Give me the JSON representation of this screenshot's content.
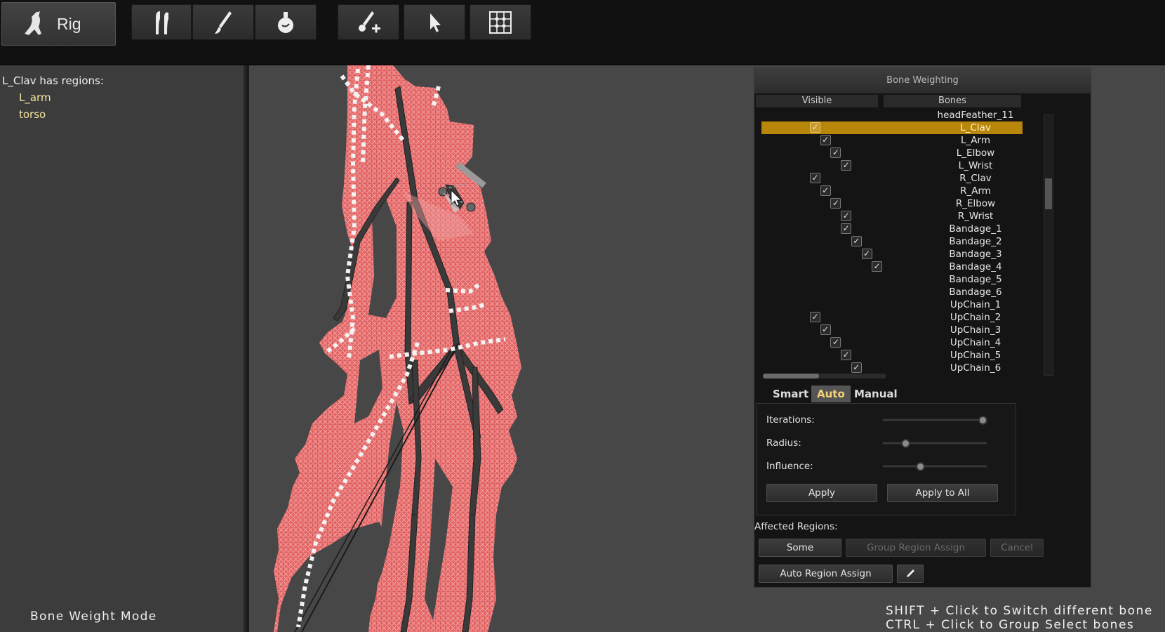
{
  "toolbar": {
    "rig_label": "Rig",
    "icons": [
      "rig-figure-icon",
      "bones-icon",
      "brush-icon",
      "weight-flask-icon",
      "add-bone-icon",
      "pointer-icon",
      "grid-icon"
    ]
  },
  "left_panel": {
    "title": "L_Clav has regions:",
    "regions": [
      "L_arm",
      "torso"
    ],
    "mode": "Bone Weight Mode"
  },
  "bone_weighting": {
    "title": "Bone Weighting",
    "col_visible": "Visible",
    "col_bones": "Bones",
    "bones": [
      {
        "name": "headFeather_11",
        "depth": -1
      },
      {
        "name": "L_Clav",
        "depth": 0,
        "selected": true
      },
      {
        "name": "L_Arm",
        "depth": 1
      },
      {
        "name": "L_Elbow",
        "depth": 2
      },
      {
        "name": "L_Wrist",
        "depth": 3
      },
      {
        "name": "R_Clav",
        "depth": 0
      },
      {
        "name": "R_Arm",
        "depth": 1
      },
      {
        "name": "R_Elbow",
        "depth": 2
      },
      {
        "name": "R_Wrist",
        "depth": 3
      },
      {
        "name": "Bandage_1",
        "depth": 3
      },
      {
        "name": "Bandage_2",
        "depth": 4
      },
      {
        "name": "Bandage_3",
        "depth": 5
      },
      {
        "name": "Bandage_4",
        "depth": 6
      },
      {
        "name": "Bandage_5",
        "depth": -1
      },
      {
        "name": "Bandage_6",
        "depth": -1
      },
      {
        "name": "UpChain_1",
        "depth": -1
      },
      {
        "name": "UpChain_2",
        "depth": 0
      },
      {
        "name": "UpChain_3",
        "depth": 1
      },
      {
        "name": "UpChain_4",
        "depth": 2
      },
      {
        "name": "UpChain_5",
        "depth": 3
      },
      {
        "name": "UpChain_6",
        "depth": 4
      }
    ],
    "tabs": [
      "Smart",
      "Auto",
      "Manual"
    ],
    "active_tab": "Auto",
    "params": [
      {
        "label": "Iterations:",
        "value": 1.0
      },
      {
        "label": "Radius:",
        "value": 0.2
      },
      {
        "label": "Influence:",
        "value": 0.35
      }
    ],
    "apply": "Apply",
    "apply_all": "Apply to All",
    "affected_label": "Affected Regions:",
    "some": "Some",
    "group_assign": "Group Region Assign",
    "cancel": "Cancel",
    "auto_assign": "Auto Region Assign",
    "edit_icon": "pencil-icon"
  },
  "hint": {
    "line1": "SHIFT + Click to Switch different bone",
    "line2": "CTRL + Click to Group Select bones"
  }
}
